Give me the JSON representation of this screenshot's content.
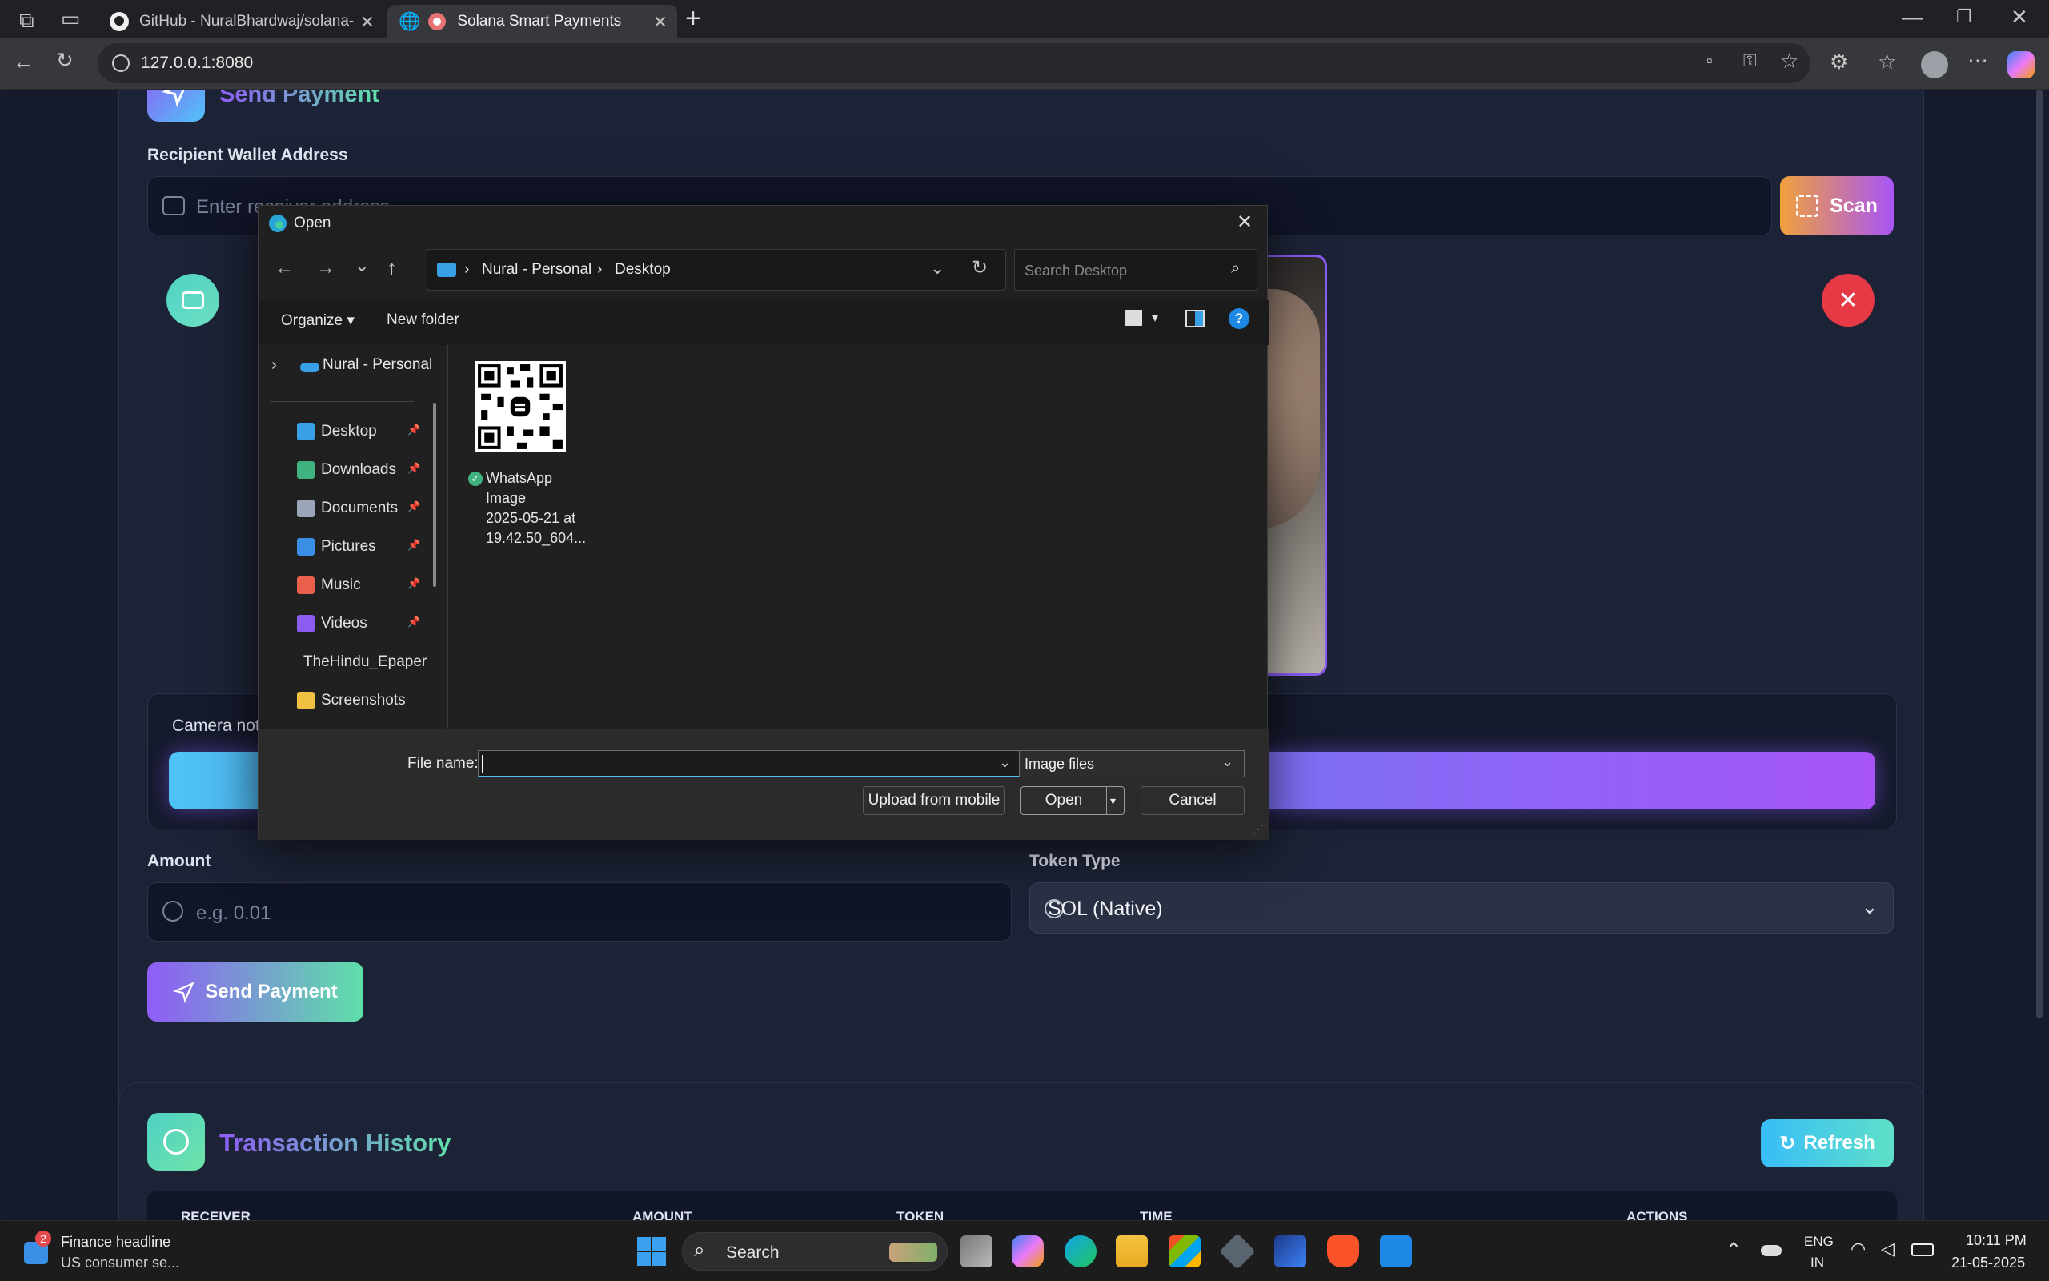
{
  "browser": {
    "tabs": [
      {
        "title": "GitHub - NuralBhardwaj/solana-s"
      },
      {
        "title": "Solana Smart Payments"
      }
    ],
    "new_tab": "+",
    "url": "127.0.0.1:8080"
  },
  "page": {
    "send_title": "Send Payment",
    "recipient_label": "Recipient Wallet Address",
    "recipient_placeholder": "Enter receiver address",
    "scan_label": "Scan",
    "camera_status": "Camera not",
    "amount_label": "Amount",
    "amount_placeholder": "e.g. 0.01",
    "token_label": "Token Type",
    "token_value": "SOL (Native)",
    "send_button": "Send Payment",
    "history_title": "Transaction History",
    "refresh_label": "Refresh",
    "columns": [
      "RECEIVER",
      "AMOUNT",
      "TOKEN",
      "TIME",
      "ACTIONS"
    ]
  },
  "dialog": {
    "title": "Open",
    "breadcrumb": [
      "Nural - Personal",
      "Desktop"
    ],
    "search_placeholder": "Search Desktop",
    "organize": "Organize",
    "new_folder": "New folder",
    "tree_root": "Nural - Personal",
    "nav": [
      {
        "label": "Desktop",
        "icon": "desktop-icon",
        "color": "#3aa0e6",
        "pinned": true
      },
      {
        "label": "Downloads",
        "icon": "download-icon",
        "color": "#3fb27f",
        "pinned": true
      },
      {
        "label": "Documents",
        "icon": "document-icon",
        "color": "#9aa6b8",
        "pinned": true
      },
      {
        "label": "Pictures",
        "icon": "picture-icon",
        "color": "#3a8ee6",
        "pinned": true
      },
      {
        "label": "Music",
        "icon": "music-icon",
        "color": "#e8604c",
        "pinned": true
      },
      {
        "label": "Videos",
        "icon": "video-icon",
        "color": "#8a5cf0",
        "pinned": true
      },
      {
        "label": "TheHindu_Epaper",
        "icon": "folder-icon",
        "color": "#f0c040",
        "pinned": false
      },
      {
        "label": "Screenshots",
        "icon": "folder-icon",
        "color": "#f0c040",
        "pinned": false
      }
    ],
    "file": {
      "line1": "WhatsApp",
      "line2": "Image",
      "line3": "2025-05-21 at",
      "line4": "19.42.50_604..."
    },
    "filename_label": "File name:",
    "filetype": "Image files",
    "upload_mobile": "Upload from mobile",
    "open": "Open",
    "cancel": "Cancel"
  },
  "taskbar": {
    "news_badge": "2",
    "news_title": "Finance headline",
    "news_sub": "US consumer se...",
    "search": "Search",
    "lang1": "ENG",
    "lang2": "IN",
    "time": "10:11 PM",
    "date": "21-05-2025"
  }
}
